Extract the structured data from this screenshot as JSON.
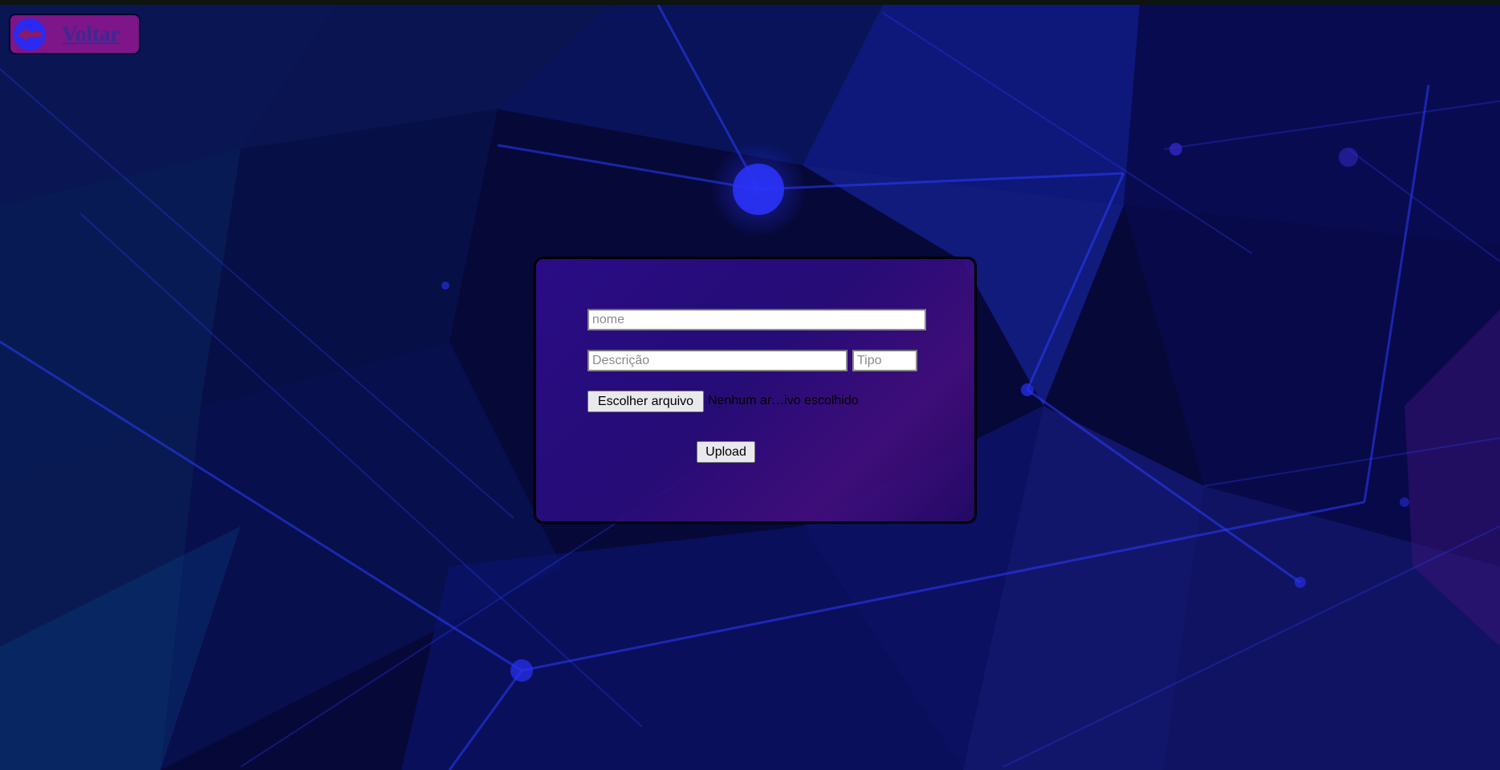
{
  "navigation": {
    "back_label": "Voltar",
    "back_icon": "arrow-left-icon"
  },
  "form": {
    "nome": {
      "placeholder": "nome",
      "value": ""
    },
    "descricao": {
      "placeholder": "Descrição",
      "value": ""
    },
    "tipo": {
      "placeholder": "Tipo",
      "value": ""
    },
    "file_button_label": "Escolher arquivo",
    "file_status": "Nenhum ar…ivo escolhido",
    "upload_label": "Upload"
  },
  "colors": {
    "background": "#07063a",
    "back_button": "#7e1588",
    "back_icon": "#2a2af2",
    "card": "#2d0c8c"
  }
}
